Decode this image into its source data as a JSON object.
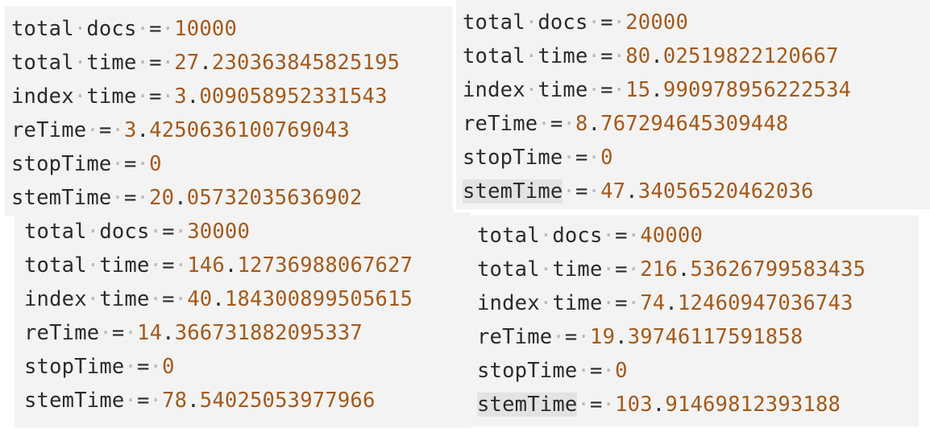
{
  "panels": [
    {
      "lines": [
        {
          "key": "total docs",
          "value": "10000"
        },
        {
          "key": "total time",
          "value": "27.230363845825195"
        },
        {
          "key": "index time",
          "value": "3.009058952331543"
        },
        {
          "key": "reTime",
          "value": "3.4250636100769043"
        },
        {
          "key": "stopTime",
          "value": "0"
        },
        {
          "key": "stemTime",
          "value": "20.05732035636902"
        }
      ]
    },
    {
      "lines": [
        {
          "key": "total docs",
          "value": "20000"
        },
        {
          "key": "total time",
          "value": "80.02519822120667"
        },
        {
          "key": "index time",
          "value": "15.990978956222534"
        },
        {
          "key": "reTime",
          "value": "8.767294645309448"
        },
        {
          "key": "stopTime",
          "value": "0"
        },
        {
          "key": "stemTime",
          "value": "47.34056520462036"
        }
      ]
    },
    {
      "lines": [
        {
          "key": "total docs",
          "value": "30000"
        },
        {
          "key": "total time",
          "value": "146.12736988067627"
        },
        {
          "key": "index time",
          "value": "40.184300899505615"
        },
        {
          "key": "reTime",
          "value": "14.366731882095337"
        },
        {
          "key": "stopTime",
          "value": "0"
        },
        {
          "key": "stemTime",
          "value": "78.54025053977966"
        }
      ]
    },
    {
      "lines": [
        {
          "key": "total docs",
          "value": "40000"
        },
        {
          "key": "total time",
          "value": "216.53626799583435"
        },
        {
          "key": "index time",
          "value": "74.12460947036743"
        },
        {
          "key": "reTime",
          "value": "19.39746117591858"
        },
        {
          "key": "stopTime",
          "value": "0"
        },
        {
          "key": "stemTime",
          "value": "103.91469812393188"
        }
      ]
    }
  ],
  "colors": {
    "background": "#f3f3f3",
    "text": "#2b2b2b",
    "number": "#a35a1c",
    "whitespace_dot": "#b9b9b9",
    "highlight": "#e2e3e3"
  }
}
